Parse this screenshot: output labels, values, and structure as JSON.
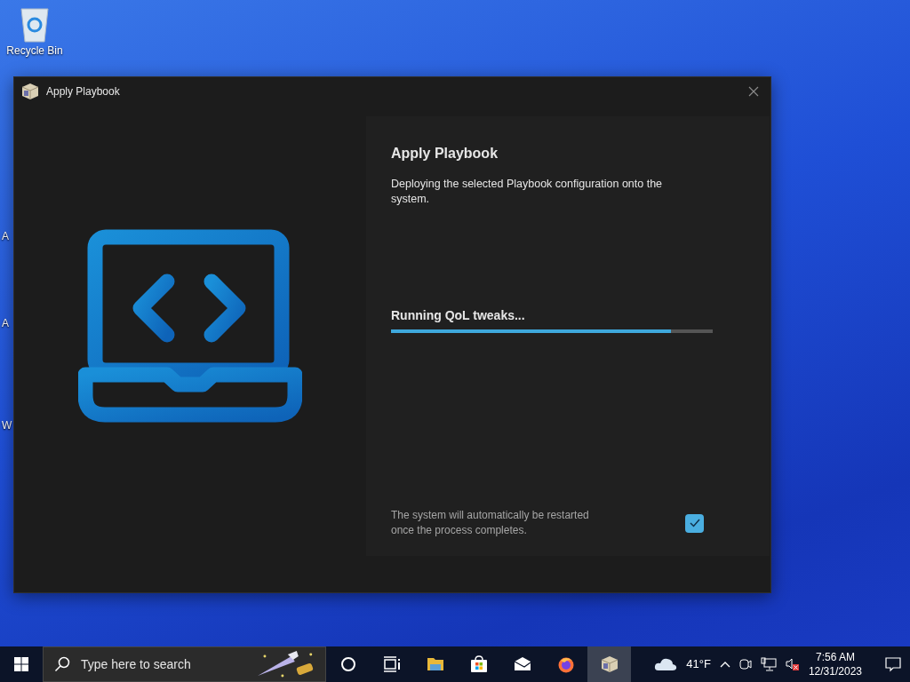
{
  "desktop": {
    "icons": [
      {
        "label": "Recycle Bin"
      }
    ],
    "edge_labels": [
      {
        "text": "A"
      },
      {
        "text": "A"
      },
      {
        "text": "W"
      }
    ]
  },
  "window": {
    "title": "Apply Playbook",
    "heading": "Apply Playbook",
    "description": "Deploying the selected Playbook configuration onto the system.",
    "progress": {
      "label": "Running QoL tweaks...",
      "level": 0.87
    },
    "restart_note": "The system will automatically be restarted once the process completes.",
    "auto_restart": {
      "checked": true
    }
  },
  "taskbar": {
    "search": {
      "placeholder": "Type here to search"
    },
    "apps": [
      {
        "kind": "cortana",
        "selected": false
      },
      {
        "kind": "taskview",
        "selected": false
      },
      {
        "kind": "explorer",
        "selected": false
      },
      {
        "kind": "store",
        "selected": false
      },
      {
        "kind": "mail",
        "selected": false
      },
      {
        "kind": "firefox",
        "selected": false
      },
      {
        "kind": "playbook",
        "selected": true
      }
    ],
    "weather": "41°F",
    "time": "7:56 AM",
    "date": "12/31/2023"
  }
}
